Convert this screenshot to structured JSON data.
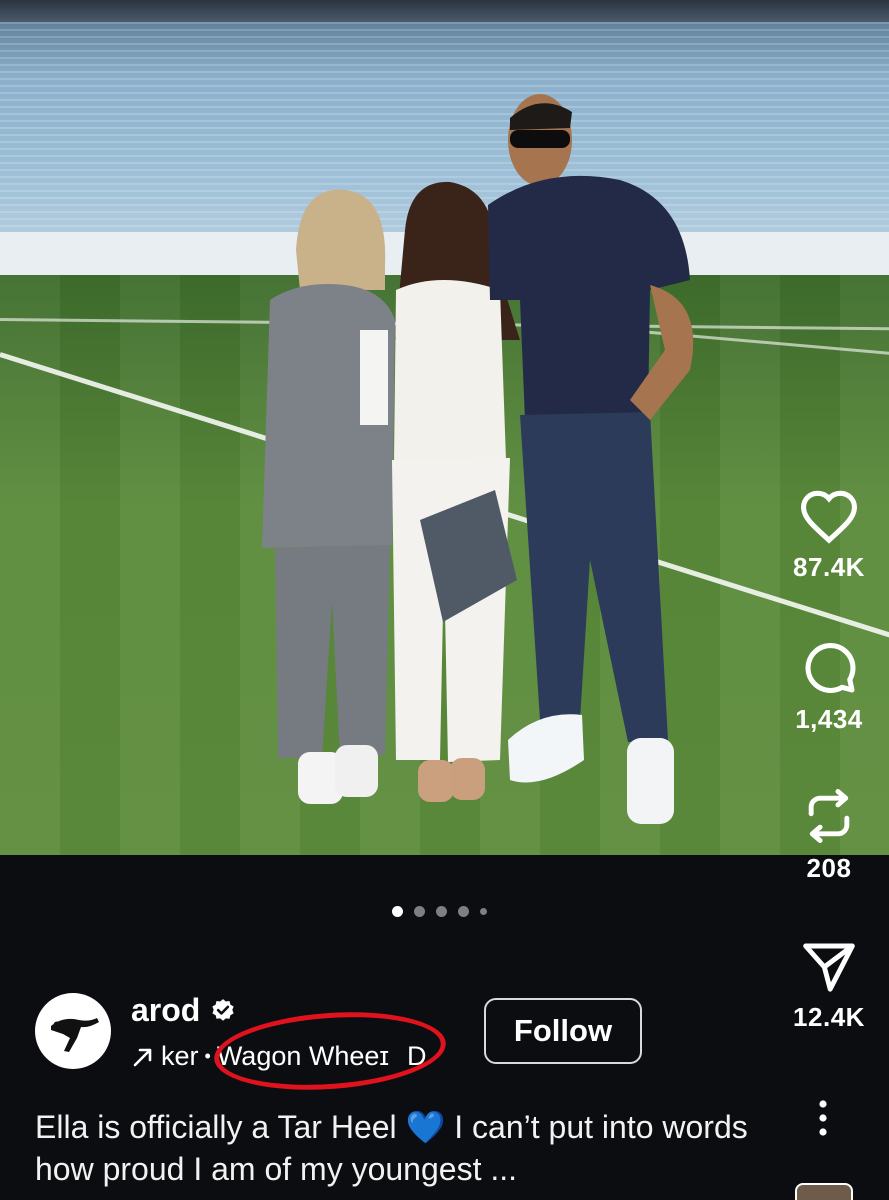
{
  "post": {
    "username": "arod",
    "meta_prefix": "ker",
    "meta_separator": "•",
    "audio_title": "Wagon Wheeɪ",
    "meta_suffix": "D",
    "follow_label": "Follow",
    "caption": "Ella is officially a Tar Heel 💙 I can’t put into words how proud I am of my youngest ...",
    "carousel": {
      "total_dots": 5,
      "active_index": 0
    }
  },
  "actions": {
    "likes": "87.4K",
    "comments": "1,434",
    "reposts": "208",
    "shares": "12.4K"
  },
  "icons": {
    "like": "heart-icon",
    "comment": "comment-bubble-icon",
    "repost": "repost-icon",
    "share": "send-icon",
    "more": "more-vertical-icon",
    "verified": "verified-badge-icon",
    "audio": "arrow-icon"
  },
  "colors": {
    "background": "#0b0d10",
    "annotation": "#e0121d",
    "text": "#ffffff"
  }
}
